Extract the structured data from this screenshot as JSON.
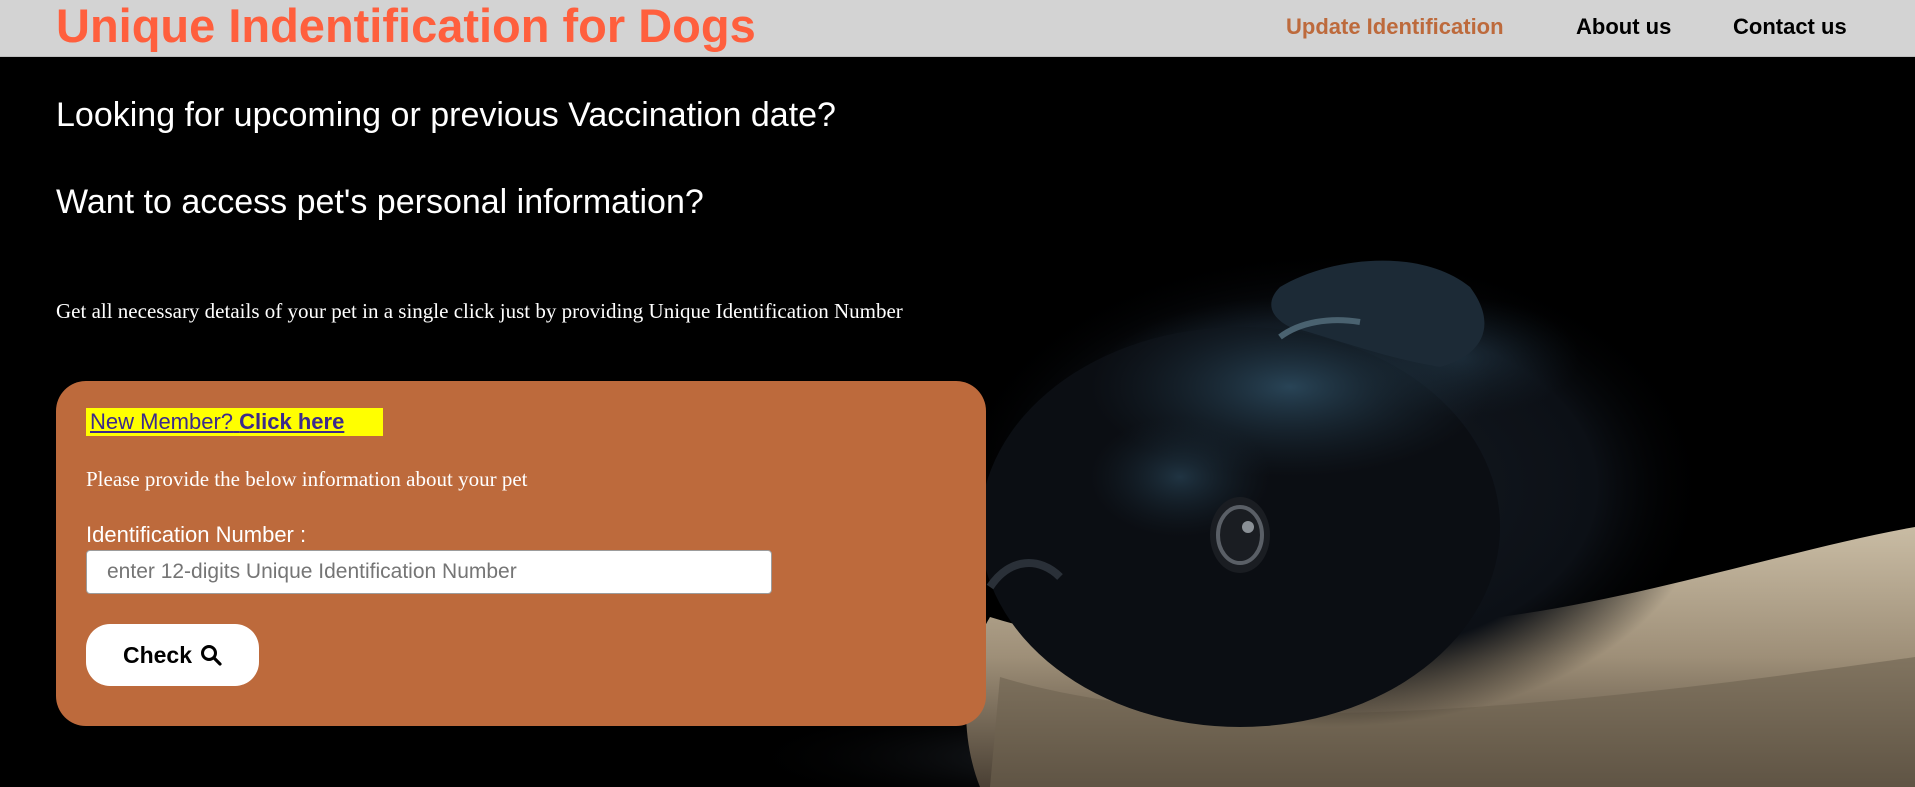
{
  "header": {
    "brand": "Unique Indentification for Dogs",
    "nav": {
      "update": "Update Identification",
      "about": "About us",
      "contact": "Contact us"
    }
  },
  "hero": {
    "headline_1": "Looking for upcoming or previous Vaccination date?",
    "headline_2": "Want to access pet's personal information?",
    "intro": "Get all necessary details of your pet in a single click just by providing Unique Identification Number"
  },
  "form": {
    "new_member_prefix": "New Member?",
    "new_member_link": "Click here",
    "instruction": "Please provide the below information about your pet",
    "id_label": "Identification Number :",
    "id_placeholder": "enter 12-digits Unique Identification Number",
    "id_value": "",
    "check_label": "Check",
    "check_icon": "search-icon"
  },
  "colors": {
    "brand": "#ff5f3d",
    "nav_active": "#bd6a3c",
    "navbar_bg": "#d3d3d3",
    "card_bg": "#bd6a3c",
    "highlight": "#ffff00",
    "page_bg": "#000000"
  }
}
